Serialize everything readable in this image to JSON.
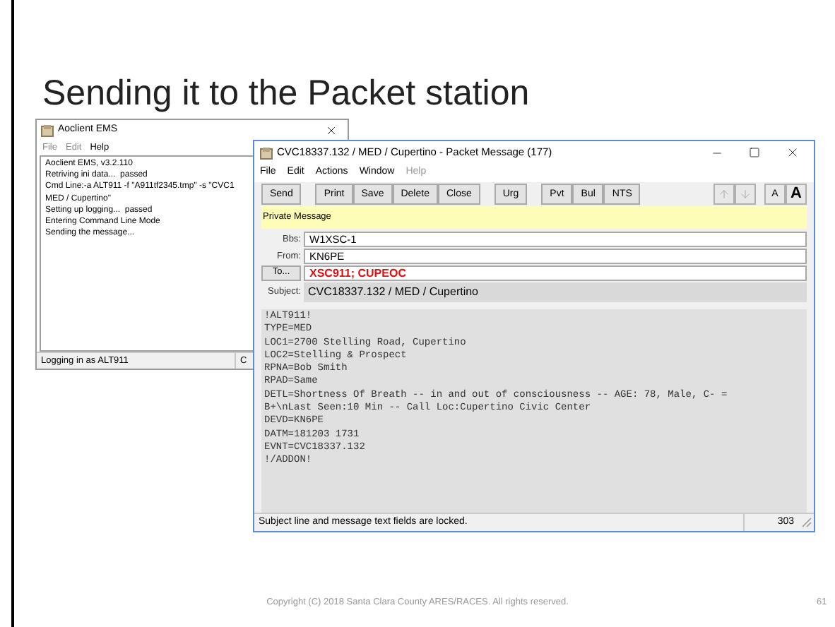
{
  "slide": {
    "title": "Sending it to the Packet station",
    "footer": "Copyright (C) 2018 Santa Clara County ARES/RACES. All rights reserved.",
    "page_number": "61"
  },
  "back_window": {
    "title": "Aoclient EMS",
    "menu": [
      {
        "label": "File",
        "disabled": true
      },
      {
        "label": "Edit",
        "disabled": true
      },
      {
        "label": "Help",
        "disabled": false
      }
    ],
    "log_lines": [
      "Aoclient EMS, v3.2.110",
      "Retriving ini data...  passed",
      "Cmd Line:-a ALT911 -f \"A911tf2345.tmp\" -s \"CVC1",
      "MED / Cupertino\"",
      "Setting up logging...  passed",
      "Entering Command Line Mode",
      "Sending the message..."
    ],
    "status_cells": [
      "Logging in as ALT911",
      "C"
    ]
  },
  "message_window": {
    "title": "CVC18337.132 / MED / Cupertino - Packet Message (177)",
    "menu": [
      {
        "label": "File",
        "disabled": false
      },
      {
        "label": "Edit",
        "disabled": false
      },
      {
        "label": "Actions",
        "disabled": false
      },
      {
        "label": "Window",
        "disabled": false
      },
      {
        "label": "Help",
        "disabled": true
      }
    ],
    "toolbar_groups": [
      [
        "Send"
      ],
      [
        "Print",
        "Save",
        "Delete",
        "Close"
      ],
      [
        "Urg"
      ],
      [
        "Pvt",
        "Bul",
        "NTS"
      ]
    ],
    "nav_buttons": [
      {
        "kind": "up",
        "disabled": true
      },
      {
        "kind": "down",
        "disabled": true
      }
    ],
    "font_buttons": [
      {
        "label": "A",
        "kind": "small"
      },
      {
        "label": "A",
        "kind": "large"
      }
    ],
    "banner": "Private Message",
    "fields": [
      {
        "label": "Bbs:",
        "value": "W1XSC-1",
        "kind": "text"
      },
      {
        "label": "From:",
        "value": "KN6PE",
        "kind": "text"
      },
      {
        "label": "To...",
        "value": "XSC911; CUPEOC",
        "kind": "recipients"
      },
      {
        "label": "Subject:",
        "value": "CVC18337.132 / MED / Cupertino",
        "kind": "locked"
      }
    ],
    "body_lines": [
      "!ALT911!",
      "TYPE=MED",
      "LOC1=2700 Stelling Road, Cupertino",
      "LOC2=Stelling & Prospect",
      "RPNA=Bob Smith",
      "RPAD=Same",
      "DETL=Shortness Of Breath -- in and out of consciousness -- AGE: 78, Male, C- =",
      "B+\\nLast Seen:10 Min -- Call Loc:Cupertino Civic Center",
      "DEVD=KN6PE",
      "DATM=181203 1731",
      "EVNT=CVC18337.132",
      "!/ADDON!"
    ],
    "status": "Subject line and message text fields are locked.",
    "char_count": "303"
  }
}
